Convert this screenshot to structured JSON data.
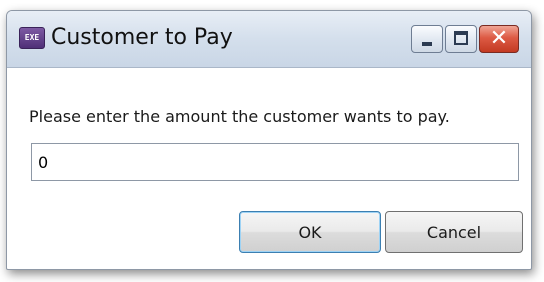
{
  "window": {
    "title": "Customer to Pay",
    "icon": {
      "name": "app-exe-icon",
      "label": "EXE",
      "color": "#5e3d88"
    }
  },
  "titlebar_buttons": {
    "minimize": "minimize-icon",
    "maximize": "maximize-icon",
    "close": "close-icon",
    "close_glyph": "✕"
  },
  "dialog": {
    "prompt": "Please enter the amount the customer wants to pay.",
    "amount_value": "0"
  },
  "buttons": {
    "ok_label": "OK",
    "cancel_label": "Cancel"
  },
  "colors": {
    "close_button": "#d44a32",
    "default_button_border": "#3c7fb1"
  }
}
